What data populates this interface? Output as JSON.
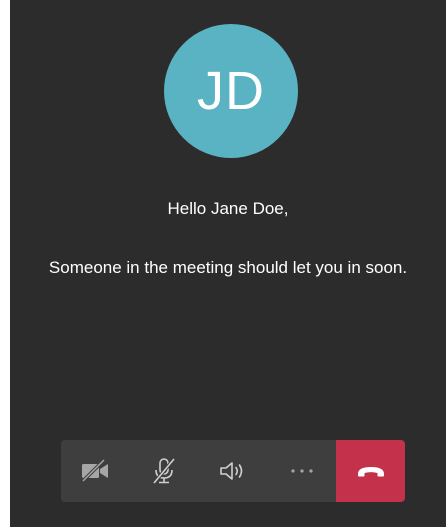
{
  "avatar": {
    "initials": "JD",
    "color": "#5ab3c3"
  },
  "lobby": {
    "greeting": "Hello Jane Doe,",
    "message": "Someone in the meeting should let you in soon."
  },
  "toolbar": {
    "buttons": [
      {
        "icon": "camera-off-icon",
        "state": "off"
      },
      {
        "icon": "mic-off-icon",
        "state": "muted"
      },
      {
        "icon": "speaker-icon",
        "state": "on"
      },
      {
        "icon": "more-options-icon"
      },
      {
        "icon": "hang-up-icon",
        "color": "#c4314b"
      }
    ]
  },
  "colors": {
    "background": "#2d2c2c",
    "toolbar": "#3f3e3e",
    "hangup": "#c4314b"
  }
}
